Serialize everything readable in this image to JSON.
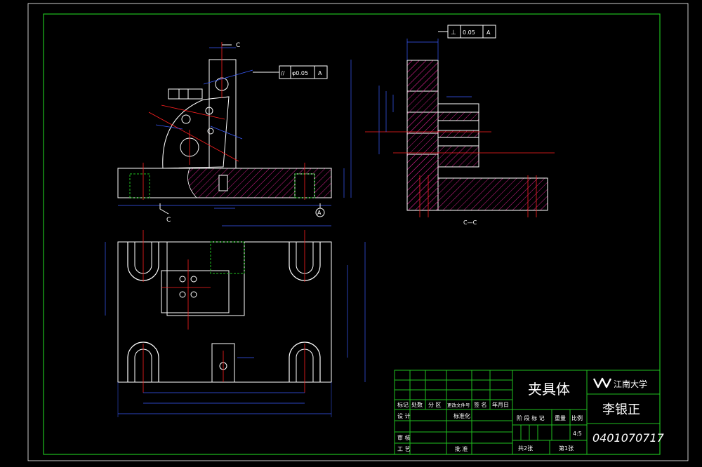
{
  "drawing": {
    "title": "夹具体",
    "university": "江南大学",
    "author": "李银正",
    "drawing_number": "0401070717",
    "scale": "4:5",
    "sheets_total": "共2张",
    "sheet_current": "第1张",
    "colors": {
      "background": "#000000",
      "border": "#1fbf1f",
      "outline": "#ffffff",
      "hatch": "#d0208a",
      "centerline": "#ff2020",
      "dimension": "#3a5cff",
      "hidden": "#1fbf1f"
    }
  },
  "title_block": {
    "row_headers": [
      "标记",
      "处数",
      "分 区",
      "更改文件号",
      "签 名",
      "年月日"
    ],
    "design": "设 计",
    "standardization": "标准化",
    "review": "审 核",
    "process": "工 艺",
    "approve": "批 准",
    "stage_mark": "阶 段 标 记",
    "weight": "重量",
    "scale_label": "比例"
  },
  "views": {
    "section_label": "C—C",
    "section_mark_c": "C",
    "datum": "A",
    "tolerance_top": {
      "symbol": "⊥",
      "value": "0.05",
      "datum": "A"
    },
    "tolerance_front": {
      "symbol": "//",
      "value": "φ0.05",
      "datum": "A"
    }
  }
}
